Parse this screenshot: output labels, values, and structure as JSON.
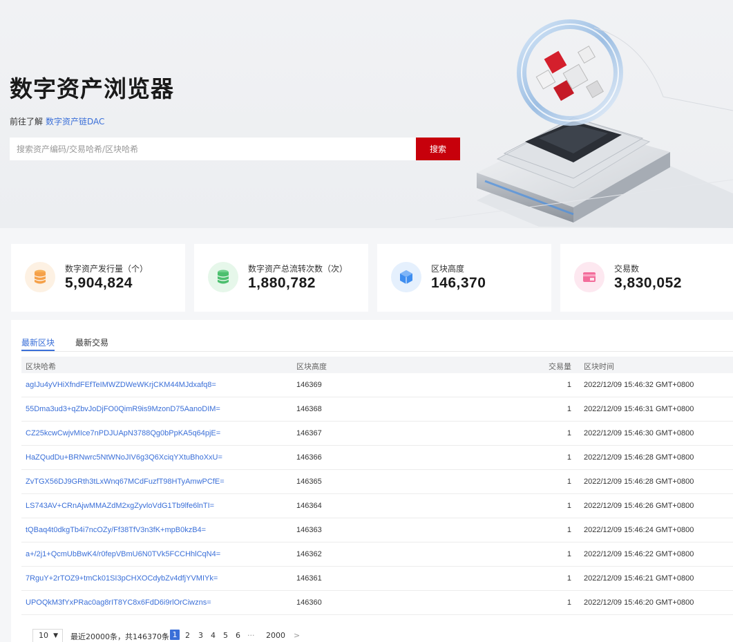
{
  "hero": {
    "title": "数字资产浏览器",
    "link_prefix": "前往了解",
    "link_text": "数字资产链DAC",
    "search_placeholder": "搜索资产编码/交易哈希/区块哈希",
    "search_button": "搜索"
  },
  "stats": [
    {
      "label": "数字资产发行量（个）",
      "value": "5,904,824",
      "icon": "database-icon",
      "color": "#f5a14a"
    },
    {
      "label": "数字资产总流转次数（次）",
      "value": "1,880,782",
      "icon": "transfer-icon",
      "color": "#4cbf6e"
    },
    {
      "label": "区块高度",
      "value": "146,370",
      "icon": "block-cube-icon",
      "color": "#3f8ef0"
    },
    {
      "label": "交易数",
      "value": "3,830,052",
      "icon": "transaction-card-icon",
      "color": "#f36d9b"
    }
  ],
  "tabs": [
    {
      "label": "最新区块",
      "active": true
    },
    {
      "label": "最新交易",
      "active": false
    }
  ],
  "table": {
    "headers": {
      "hash": "区块哈希",
      "height": "区块高度",
      "count": "交易量",
      "time": "区块时间"
    },
    "rows": [
      {
        "hash": "agIJu4yVHiXfndFEfTeIMWZDWeWKrjCKM44MJdxafq8=",
        "height": "146369",
        "count": "1",
        "time": "2022/12/09 15:46:32 GMT+0800"
      },
      {
        "hash": "55Dma3ud3+qZbvJoDjFO0QimR9is9MzonD75AanoDIM=",
        "height": "146368",
        "count": "1",
        "time": "2022/12/09 15:46:31 GMT+0800"
      },
      {
        "hash": "CZ25kcwCwjvMIce7nPDJUApN3788Qg0bPpKA5q64pjE=",
        "height": "146367",
        "count": "1",
        "time": "2022/12/09 15:46:30 GMT+0800"
      },
      {
        "hash": "HaZQudDu+BRNwrc5NtWNoJIV6g3Q6XciqYXtuBhoXxU=",
        "height": "146366",
        "count": "1",
        "time": "2022/12/09 15:46:28 GMT+0800"
      },
      {
        "hash": "ZvTGX56DJ9GRth3tLxWnq67MCdFuzfT98HTyAmwPCfE=",
        "height": "146365",
        "count": "1",
        "time": "2022/12/09 15:46:28 GMT+0800"
      },
      {
        "hash": "LS743AV+CRnAjwMMAZdM2xgZyvloVdG1Tb9lfe6lnTI=",
        "height": "146364",
        "count": "1",
        "time": "2022/12/09 15:46:26 GMT+0800"
      },
      {
        "hash": "tQBaq4t0dkgTb4i7ncOZy/Ff38TfV3n3fK+mpB0kzB4=",
        "height": "146363",
        "count": "1",
        "time": "2022/12/09 15:46:24 GMT+0800"
      },
      {
        "hash": "a+/2j1+QcmUbBwK4/r0fepVBmU6N0TVk5FCCHhlCqN4=",
        "height": "146362",
        "count": "1",
        "time": "2022/12/09 15:46:22 GMT+0800"
      },
      {
        "hash": "7RguY+2rTOZ9+tmCk01SI3pCHXOCdybZv4dfjYVMIYk=",
        "height": "146361",
        "count": "1",
        "time": "2022/12/09 15:46:21 GMT+0800"
      },
      {
        "hash": "UPOQkM3fYxPRac0ag8rIT8YC8x6FdD6i9rlOrCiwzns=",
        "height": "146360",
        "count": "1",
        "time": "2022/12/09 15:46:20 GMT+0800"
      }
    ]
  },
  "pagination": {
    "page_size": "10",
    "summary": "最近20000条，共146370条",
    "prev": "<",
    "next": ">",
    "pages": [
      "1",
      "2",
      "3",
      "4",
      "5",
      "6",
      "···",
      "2000"
    ],
    "current": "1"
  },
  "colors": {
    "brand_red": "#c7000b",
    "link_blue": "#3a6fd8"
  }
}
